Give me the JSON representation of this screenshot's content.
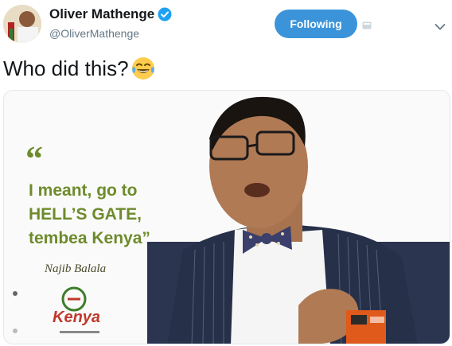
{
  "tweet": {
    "display_name": "Oliver Mathenge",
    "handle": "@OliverMathenge",
    "follow_label": "Following",
    "text": "Who did this?",
    "emoji": "face-with-tears-of-joy"
  },
  "media": {
    "quote_line1": "I meant, go to",
    "quote_line2": "HELL’S GATE,",
    "quote_line3": "tembea Kenya”",
    "quote_open": "“",
    "signature": "Najib Balala",
    "logo": "Kenya"
  },
  "colors": {
    "follow_button": "#3b94d9",
    "verified": "#1da1f2",
    "quote_green": "#6e8b2c"
  }
}
